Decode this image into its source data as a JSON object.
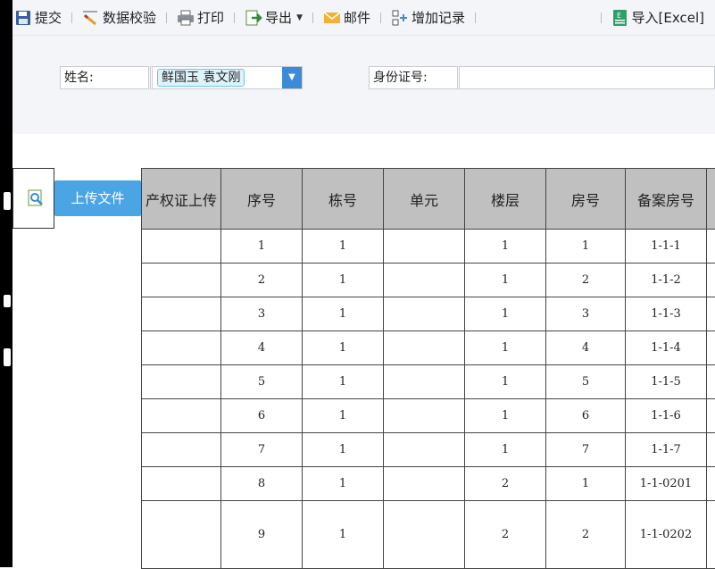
{
  "toolbar": {
    "submit": "提交",
    "validate": "数据校验",
    "print": "打印",
    "export": "导出",
    "email": "邮件",
    "add_record": "增加记录",
    "import_excel": "导入[Excel]"
  },
  "filter": {
    "name_label": "姓名:",
    "name_value": "鲜国玉 袁文刚",
    "id_label": "身份证号:",
    "id_value": ""
  },
  "upload_label": "上传文件",
  "table": {
    "headers": [
      "产权证上传",
      "序号",
      "栋号",
      "单元",
      "楼层",
      "房号",
      "备案房号"
    ],
    "rows": [
      {
        "seq": "1",
        "building": "1",
        "unit": "",
        "floor": "1",
        "room": "1",
        "record": "1-1-1"
      },
      {
        "seq": "2",
        "building": "1",
        "unit": "",
        "floor": "1",
        "room": "2",
        "record": "1-1-2"
      },
      {
        "seq": "3",
        "building": "1",
        "unit": "",
        "floor": "1",
        "room": "3",
        "record": "1-1-3"
      },
      {
        "seq": "4",
        "building": "1",
        "unit": "",
        "floor": "1",
        "room": "4",
        "record": "1-1-4"
      },
      {
        "seq": "5",
        "building": "1",
        "unit": "",
        "floor": "1",
        "room": "5",
        "record": "1-1-5"
      },
      {
        "seq": "6",
        "building": "1",
        "unit": "",
        "floor": "1",
        "room": "6",
        "record": "1-1-6"
      },
      {
        "seq": "7",
        "building": "1",
        "unit": "",
        "floor": "1",
        "room": "7",
        "record": "1-1-7"
      },
      {
        "seq": "8",
        "building": "1",
        "unit": "",
        "floor": "2",
        "room": "1",
        "record": "1-1-0201"
      },
      {
        "seq": "9",
        "building": "1",
        "unit": "",
        "floor": "2",
        "room": "2",
        "record": "1-1-0202"
      }
    ]
  },
  "colors": {
    "toolbar_bg": "#f3f5f8",
    "accent": "#4ba5e4",
    "dropdown": "#3d8bd7",
    "header_bg": "#c0c0c0",
    "chip_bg": "#dff3fb"
  }
}
